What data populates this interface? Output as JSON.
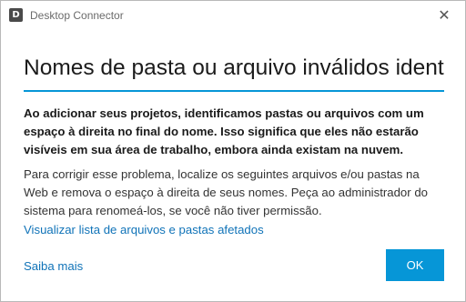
{
  "window": {
    "icon_letter": "D",
    "title": "Desktop Connector",
    "close_icon": "close-icon"
  },
  "dialog": {
    "heading": "Nomes de pasta ou arquivo inválidos identi",
    "bold_text": "Ao adicionar seus projetos, identificamos pastas ou arquivos com um espaço à direita no final do nome. Isso significa que eles não estarão visíveis em sua área de trabalho, embora ainda existam na nuvem.",
    "body_text": "Para corrigir esse problema, localize os seguintes arquivos e/ou pastas na Web e remova o espaço à direita de seus nomes. Peça ao administrador do sistema para renomeá-los, se você não tiver permissão.",
    "view_link": "Visualizar lista de arquivos e pastas afetados",
    "learn_more_link": "Saiba mais",
    "ok_label": "OK"
  },
  "colors": {
    "accent": "#0696d7",
    "link": "#1073b8"
  }
}
